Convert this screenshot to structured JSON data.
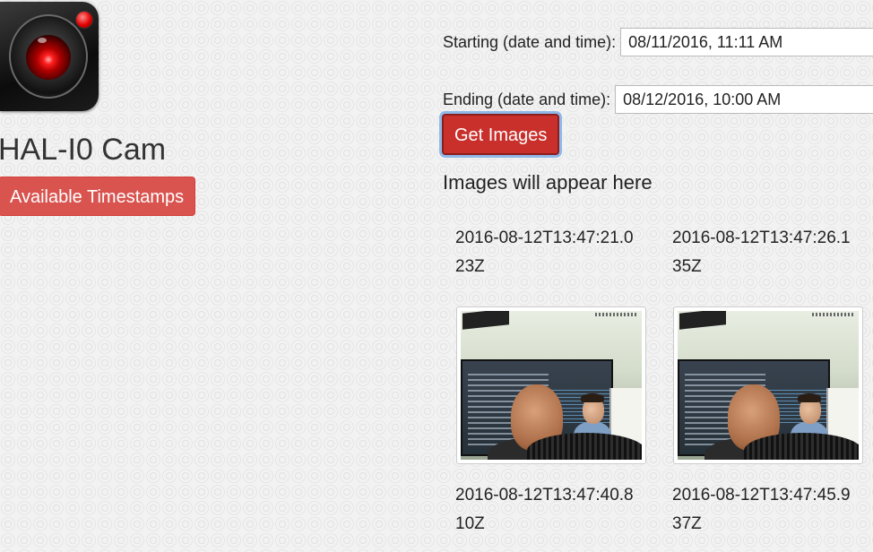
{
  "app": {
    "title": "HAL-I0 Cam",
    "logo_icon": "camera-lens-icon",
    "timestamps_button_label": "Available Timestamps"
  },
  "query": {
    "start_label": "Starting (date and time):",
    "start_value": "08/11/2016, 11:11 AM",
    "end_label": "Ending (date and time):",
    "end_value": "08/12/2016, 10:00 AM",
    "get_images_label": "Get Images"
  },
  "results": {
    "heading": "Images will appear here",
    "images": [
      {
        "timestamp": "2016-08-12T13:47:21.023Z"
      },
      {
        "timestamp": "2016-08-12T13:47:26.135Z"
      },
      {
        "timestamp": "2016-08-12T13:47:40.810Z"
      },
      {
        "timestamp": "2016-08-12T13:47:45.937Z"
      }
    ]
  },
  "colors": {
    "danger_button": "#d9534f",
    "active_button": "#c9302c",
    "focus_ring": "#8fb8e8"
  }
}
